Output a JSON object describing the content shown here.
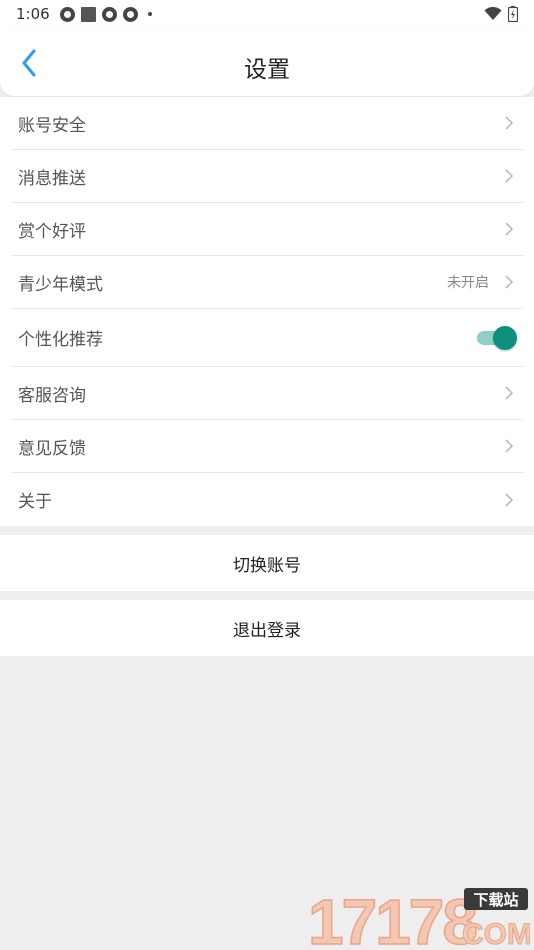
{
  "status_bar": {
    "time": "1:06"
  },
  "header": {
    "title": "设置"
  },
  "settings": {
    "items": [
      {
        "label": "账号安全"
      },
      {
        "label": "消息推送"
      },
      {
        "label": "赏个好评"
      },
      {
        "label": "青少年模式",
        "value": "未开启"
      },
      {
        "label": "个性化推荐",
        "toggle_on": true
      },
      {
        "label": "客服咨询"
      },
      {
        "label": "意见反馈"
      },
      {
        "label": "关于"
      }
    ]
  },
  "actions": {
    "switch_account": "切换账号",
    "logout": "退出登录"
  },
  "watermark": {
    "number": "17178",
    "tag": "下载站",
    "domain": "COM"
  },
  "colors": {
    "accent_blue": "#2a9df4",
    "toggle_thumb": "#0e8f7e",
    "toggle_track": "#8fd0c6"
  }
}
